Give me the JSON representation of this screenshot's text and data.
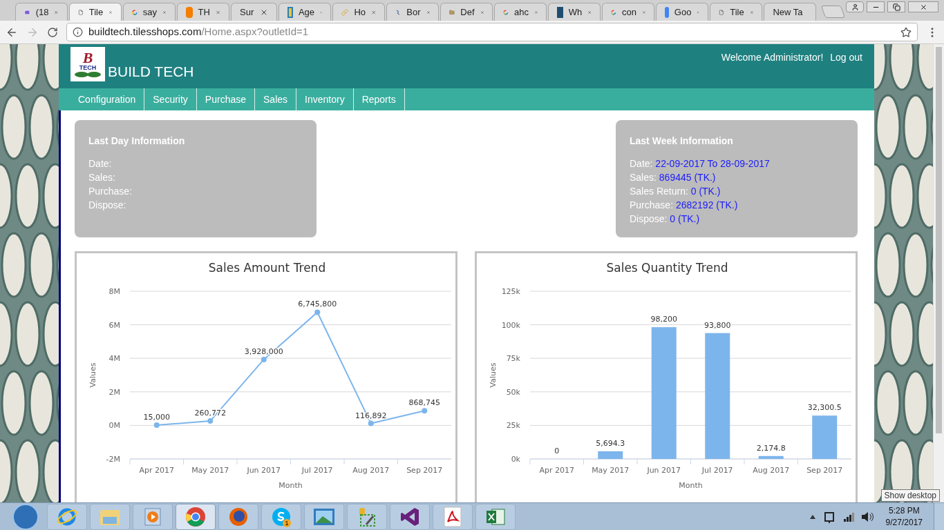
{
  "browser": {
    "tabs": [
      {
        "label": "(18",
        "kind": "mail",
        "selected": false
      },
      {
        "label": "Tile",
        "kind": "page",
        "selected": true
      },
      {
        "label": "say",
        "kind": "google",
        "selected": false
      },
      {
        "label": "TH",
        "kind": "blogger",
        "selected": false
      },
      {
        "label": "Sur",
        "kind": "none",
        "selected": false
      },
      {
        "label": "Age",
        "kind": "puzzle",
        "selected": false
      },
      {
        "label": "Ho",
        "kind": "link",
        "selected": false
      },
      {
        "label": "Bor",
        "kind": "spiral",
        "selected": false
      },
      {
        "label": "Def",
        "kind": "folder",
        "selected": false
      },
      {
        "label": "ahc",
        "kind": "google",
        "selected": false
      },
      {
        "label": "Wh",
        "kind": "vlogo",
        "selected": false
      },
      {
        "label": "con",
        "kind": "google",
        "selected": false
      },
      {
        "label": "Goo",
        "kind": "translate",
        "selected": false
      },
      {
        "label": "Tile",
        "kind": "page",
        "selected": false
      },
      {
        "label": "New Ta",
        "kind": "none",
        "selected": false
      }
    ],
    "url": {
      "host": "buildtech.tilesshops.com",
      "path": "/Home.aspx?outletId=1"
    }
  },
  "header": {
    "brand": "BUILD TECH",
    "logo_letter": "B",
    "logo_word": "TECH",
    "welcome": "Welcome Administrator!",
    "logout": "Log out"
  },
  "nav": [
    "Configuration",
    "Security",
    "Purchase",
    "Sales",
    "Inventory",
    "Reports"
  ],
  "last_day": {
    "title": "Last Day Information",
    "rows": [
      {
        "label": "Date:"
      },
      {
        "label": "Sales:"
      },
      {
        "label": "Purchase:"
      },
      {
        "label": "Dispose:"
      }
    ]
  },
  "last_week": {
    "title": "Last Week Information",
    "rows": [
      {
        "label": "Date:",
        "value": "22-09-2017 To 28-09-2017"
      },
      {
        "label": "Sales:",
        "value": "869445 (TK.)"
      },
      {
        "label": "Sales Return:",
        "value": "0 (TK.)"
      },
      {
        "label": "Purchase:",
        "value": "2682192 (TK.)"
      },
      {
        "label": "Dispose:",
        "value": "0 (TK.)"
      }
    ]
  },
  "charts": [
    {
      "chart_data": {
        "type": "line",
        "title": "Sales Amount Trend",
        "xlabel": "Month",
        "ylabel": "Values",
        "categories": [
          "Apr 2017",
          "May 2017",
          "Jun 2017",
          "Jul 2017",
          "Aug 2017",
          "Sep 2017"
        ],
        "grid": true,
        "series": [
          {
            "color": "#7cb5ec",
            "marker": true,
            "values": [
              15000,
              260772,
              3928000,
              6745800,
              116892,
              868745
            ]
          }
        ],
        "value_labels": [
          "15,000",
          "260,772",
          "3,928,000",
          "6,745,800",
          "116,892",
          "868,745"
        ],
        "ylim": [
          -2000000,
          8000000
        ],
        "yticks": [
          {
            "value": -2000000,
            "label": "-2M"
          },
          {
            "value": 0,
            "label": "0M"
          },
          {
            "value": 2000000,
            "label": "2M"
          },
          {
            "value": 4000000,
            "label": "4M"
          },
          {
            "value": 6000000,
            "label": "6M"
          },
          {
            "value": 8000000,
            "label": "8M"
          }
        ]
      }
    },
    {
      "chart_data": {
        "type": "bar",
        "title": "Sales Quantity Trend",
        "xlabel": "Month",
        "ylabel": "Values",
        "categories": [
          "Apr 2017",
          "May 2017",
          "Jun 2017",
          "Jul 2017",
          "Aug 2017",
          "Sep 2017"
        ],
        "grid": true,
        "series": [
          {
            "color": "#7cb5ec",
            "values": [
              0,
              5694.3,
              98200,
              93800,
              2174.8,
              32300.5
            ]
          }
        ],
        "value_labels": [
          "0",
          "5,694.3",
          "98,200",
          "93,800",
          "2,174.8",
          "32,300.5"
        ],
        "ylim": [
          0,
          125000
        ],
        "yticks": [
          {
            "value": 0,
            "label": "0k"
          },
          {
            "value": 25000,
            "label": "25k"
          },
          {
            "value": 50000,
            "label": "50k"
          },
          {
            "value": 75000,
            "label": "75k"
          },
          {
            "value": 100000,
            "label": "100k"
          },
          {
            "value": 125000,
            "label": "125k"
          }
        ]
      }
    }
  ],
  "taskbar": {
    "apps": [
      {
        "kind": "ie",
        "selected": false
      },
      {
        "kind": "explorer",
        "selected": false
      },
      {
        "kind": "media",
        "selected": false
      },
      {
        "kind": "chrome",
        "selected": true
      },
      {
        "kind": "firefox",
        "selected": false
      },
      {
        "kind": "skype",
        "selected": false,
        "badge": "1"
      },
      {
        "kind": "photo",
        "selected": false
      },
      {
        "kind": "tools",
        "selected": false
      },
      {
        "kind": "vs",
        "selected": false
      },
      {
        "kind": "pdf",
        "selected": false
      },
      {
        "kind": "excel",
        "selected": false
      }
    ],
    "time": "5:28 PM",
    "date": "9/27/2017",
    "tooltip": "Show desktop"
  }
}
